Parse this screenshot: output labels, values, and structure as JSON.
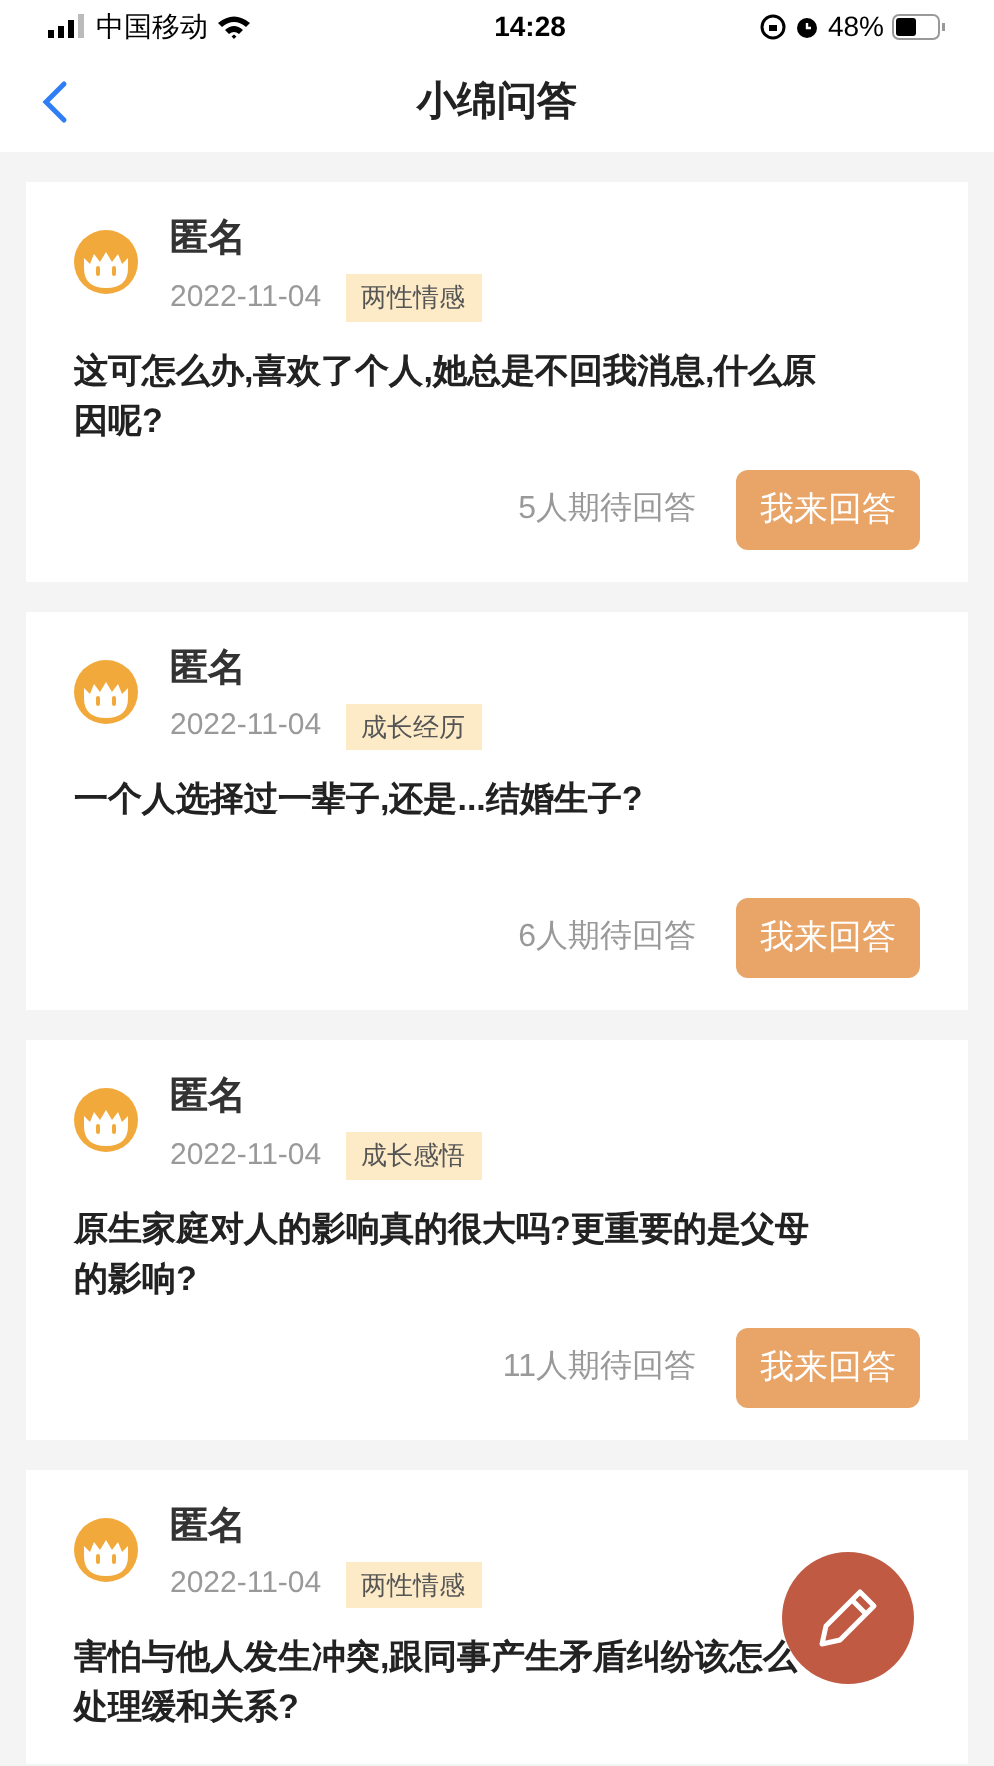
{
  "status_bar": {
    "carrier": "中国移动",
    "time": "14:28",
    "battery": "48%"
  },
  "nav": {
    "title": "小绵问答"
  },
  "questions": [
    {
      "author": "匿名",
      "date": "2022-11-04",
      "tag": "两性情感",
      "text": "这可怎么办,喜欢了个人,她总是不回我消息,什么原因呢?",
      "waiting": "5人期待回答",
      "action": "我来回答"
    },
    {
      "author": "匿名",
      "date": "2022-11-04",
      "tag": "成长经历",
      "text": "一个人选择过一辈子,还是...结婚生子?",
      "waiting": "6人期待回答",
      "action": "我来回答"
    },
    {
      "author": "匿名",
      "date": "2022-11-04",
      "tag": "成长感悟",
      "text": "原生家庭对人的影响真的很大吗?更重要的是父母的影响?",
      "waiting": "11人期待回答",
      "action": "我来回答"
    },
    {
      "author": "匿名",
      "date": "2022-11-04",
      "tag": "两性情感",
      "text": "害怕与他人发生冲突,跟同事产生矛盾纠纷该怎么处理缓和关系?"
    }
  ]
}
